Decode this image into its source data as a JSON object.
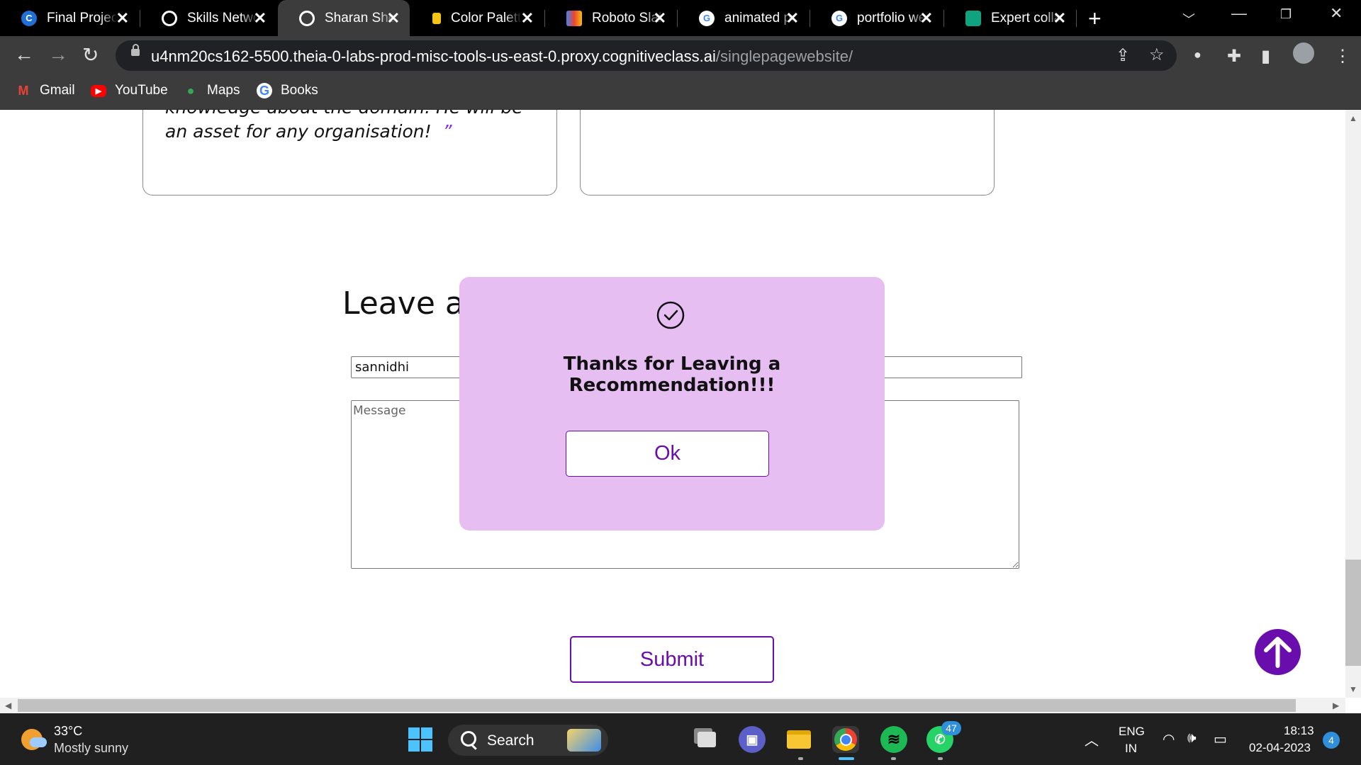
{
  "browser": {
    "tabs": [
      {
        "title": "Final Project",
        "icon": "coursera-c-icon",
        "letter": "C",
        "color": "#1f6fd6"
      },
      {
        "title": "Skills Network",
        "icon": "globe-icon",
        "letter": "",
        "color": "#ffffff"
      },
      {
        "title": "Sharan Shetty",
        "icon": "globe-icon",
        "letter": "",
        "color": "#ffffff"
      },
      {
        "title": "Color Palette",
        "icon": "palette-icon",
        "letter": "",
        "color": "#f5c518"
      },
      {
        "title": "Roboto Slab",
        "icon": "google-fonts-icon",
        "letter": "",
        "color": "#4285f4"
      },
      {
        "title": "animated pop",
        "icon": "google-g-icon",
        "letter": "G",
        "color": "#ffffff"
      },
      {
        "title": "portfolio web",
        "icon": "google-g-icon",
        "letter": "G",
        "color": "#ffffff"
      },
      {
        "title": "Expert collab",
        "icon": "openai-icon",
        "letter": "",
        "color": "#10a37f"
      }
    ],
    "active_tab_index": 2,
    "url_host": "u4nm20cs162-5500.theia-0-labs-prod-misc-tools-us-east-0.proxy.cognitiveclass.ai",
    "url_path": "/singlepagewebsite/",
    "bookmarks": [
      {
        "label": "Gmail",
        "icon": "gmail-icon",
        "letter": "M",
        "color": "#ea4335"
      },
      {
        "label": "YouTube",
        "icon": "youtube-icon",
        "letter": "▶",
        "color": "#ff0000"
      },
      {
        "label": "Maps",
        "icon": "maps-pin-icon",
        "letter": "●",
        "color": "#34a853"
      },
      {
        "label": "Books",
        "icon": "google-g-icon",
        "letter": "G",
        "color": "#4285f4"
      }
    ]
  },
  "page": {
    "recommendation_quote_line1": "knowledge about the domain. He will be",
    "recommendation_quote_line2": "an asset for any organisation!",
    "quote_close_mark": "”",
    "leave_title": "Leave a",
    "name_value": "sannidhi",
    "message_placeholder": "Message",
    "submit_label": "Submit"
  },
  "modal": {
    "message": "Thanks for Leaving a Recommendation!!!",
    "ok_label": "Ok"
  },
  "taskbar": {
    "temperature": "33°C",
    "weather": "Mostly sunny",
    "search_label": "Search",
    "whatsapp_badge": "47",
    "lang_top": "ENG",
    "lang_bottom": "IN",
    "time": "18:13",
    "date": "02-04-2023",
    "notifications": "4"
  },
  "colors": {
    "accent": "#6a0dad",
    "modal_bg": "#e6bef2"
  }
}
